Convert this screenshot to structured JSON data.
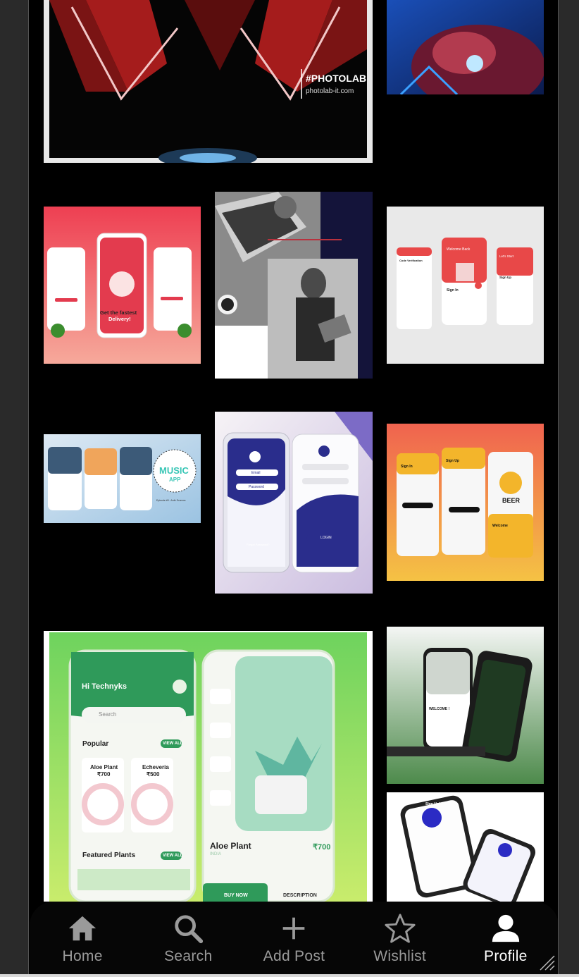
{
  "nav": {
    "items": [
      {
        "label": "Home",
        "icon": "home-icon",
        "active": false
      },
      {
        "label": "Search",
        "icon": "search-icon",
        "active": false
      },
      {
        "label": "Add Post",
        "icon": "plus-icon",
        "active": false
      },
      {
        "label": "Wishlist",
        "icon": "star-icon",
        "active": false
      },
      {
        "label": "Profile",
        "icon": "person-icon",
        "active": true
      }
    ]
  },
  "posts": {
    "photolab": {
      "tag": "#PHOTOLAB",
      "site": "photolab-it.com"
    },
    "delivery": {
      "line1": "Get the fastest",
      "line2": "Delivery!"
    },
    "signin": {
      "welcome": "Welcome Back",
      "signin": "Sign In",
      "signup": "Sign Up",
      "verify": "Code Verification",
      "start": "Let's Start"
    },
    "music": {
      "brand": "MUSIC",
      "app": "APP",
      "caption": "Episode #8 - Auth Screens"
    },
    "blue": {
      "email": "Email",
      "password": "Password",
      "login": "LOGIN",
      "forgot": "Forgot Password?"
    },
    "beer": {
      "logo": "BEER",
      "signin": "Sign In",
      "signup": "Sign Up",
      "welcome": "Welcome"
    },
    "plants": {
      "greeting": "Hi Technyks",
      "search": "Search",
      "popular": "Popular",
      "view_all": "VIEW ALL",
      "featured": "Featured Plants",
      "p1_name": "Aloe Plant",
      "p1_price": "₹700",
      "p2_name": "Echeveria",
      "p2_price": "₹500",
      "detail_name": "Aloe Plant",
      "detail_price": "₹700",
      "detail_origin": "INDIA",
      "buy": "BUY NOW",
      "description": "DESCRIPTION"
    },
    "green": {
      "welcome": "WELCOME !"
    },
    "signup": {
      "title": "Sign Up!"
    }
  },
  "colors": {
    "active": "#ffffff",
    "inactive": "#9a9a9a",
    "nav_bg": "#060606"
  }
}
